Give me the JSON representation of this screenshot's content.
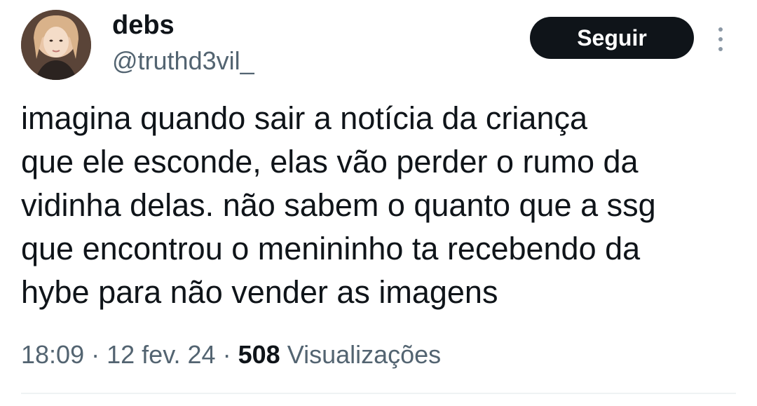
{
  "author": {
    "display_name": "debs",
    "handle": "@truthd3vil_",
    "avatar_icon": "profile-photo"
  },
  "follow_button": {
    "label": "Seguir"
  },
  "more_options": {
    "icon": "more-vertical-icon"
  },
  "tweet": {
    "text_lines": [
      "imagina quando sair a notícia da criança",
      "que ele esconde, elas vão perder o rumo da",
      "vidinha delas. não sabem o quanto que a ssg",
      "que encontrou o menininho ta recebendo da",
      "hybe para não vender as imagens"
    ]
  },
  "meta": {
    "time": "18:09",
    "separator": "·",
    "date": "12 fev. 24",
    "views_count": "508",
    "views_label": "Visualizações"
  },
  "colors": {
    "text_primary": "#0f1419",
    "text_secondary": "#536471",
    "button_bg": "#0f1419",
    "button_text": "#ffffff",
    "divider": "#eff3f4"
  }
}
